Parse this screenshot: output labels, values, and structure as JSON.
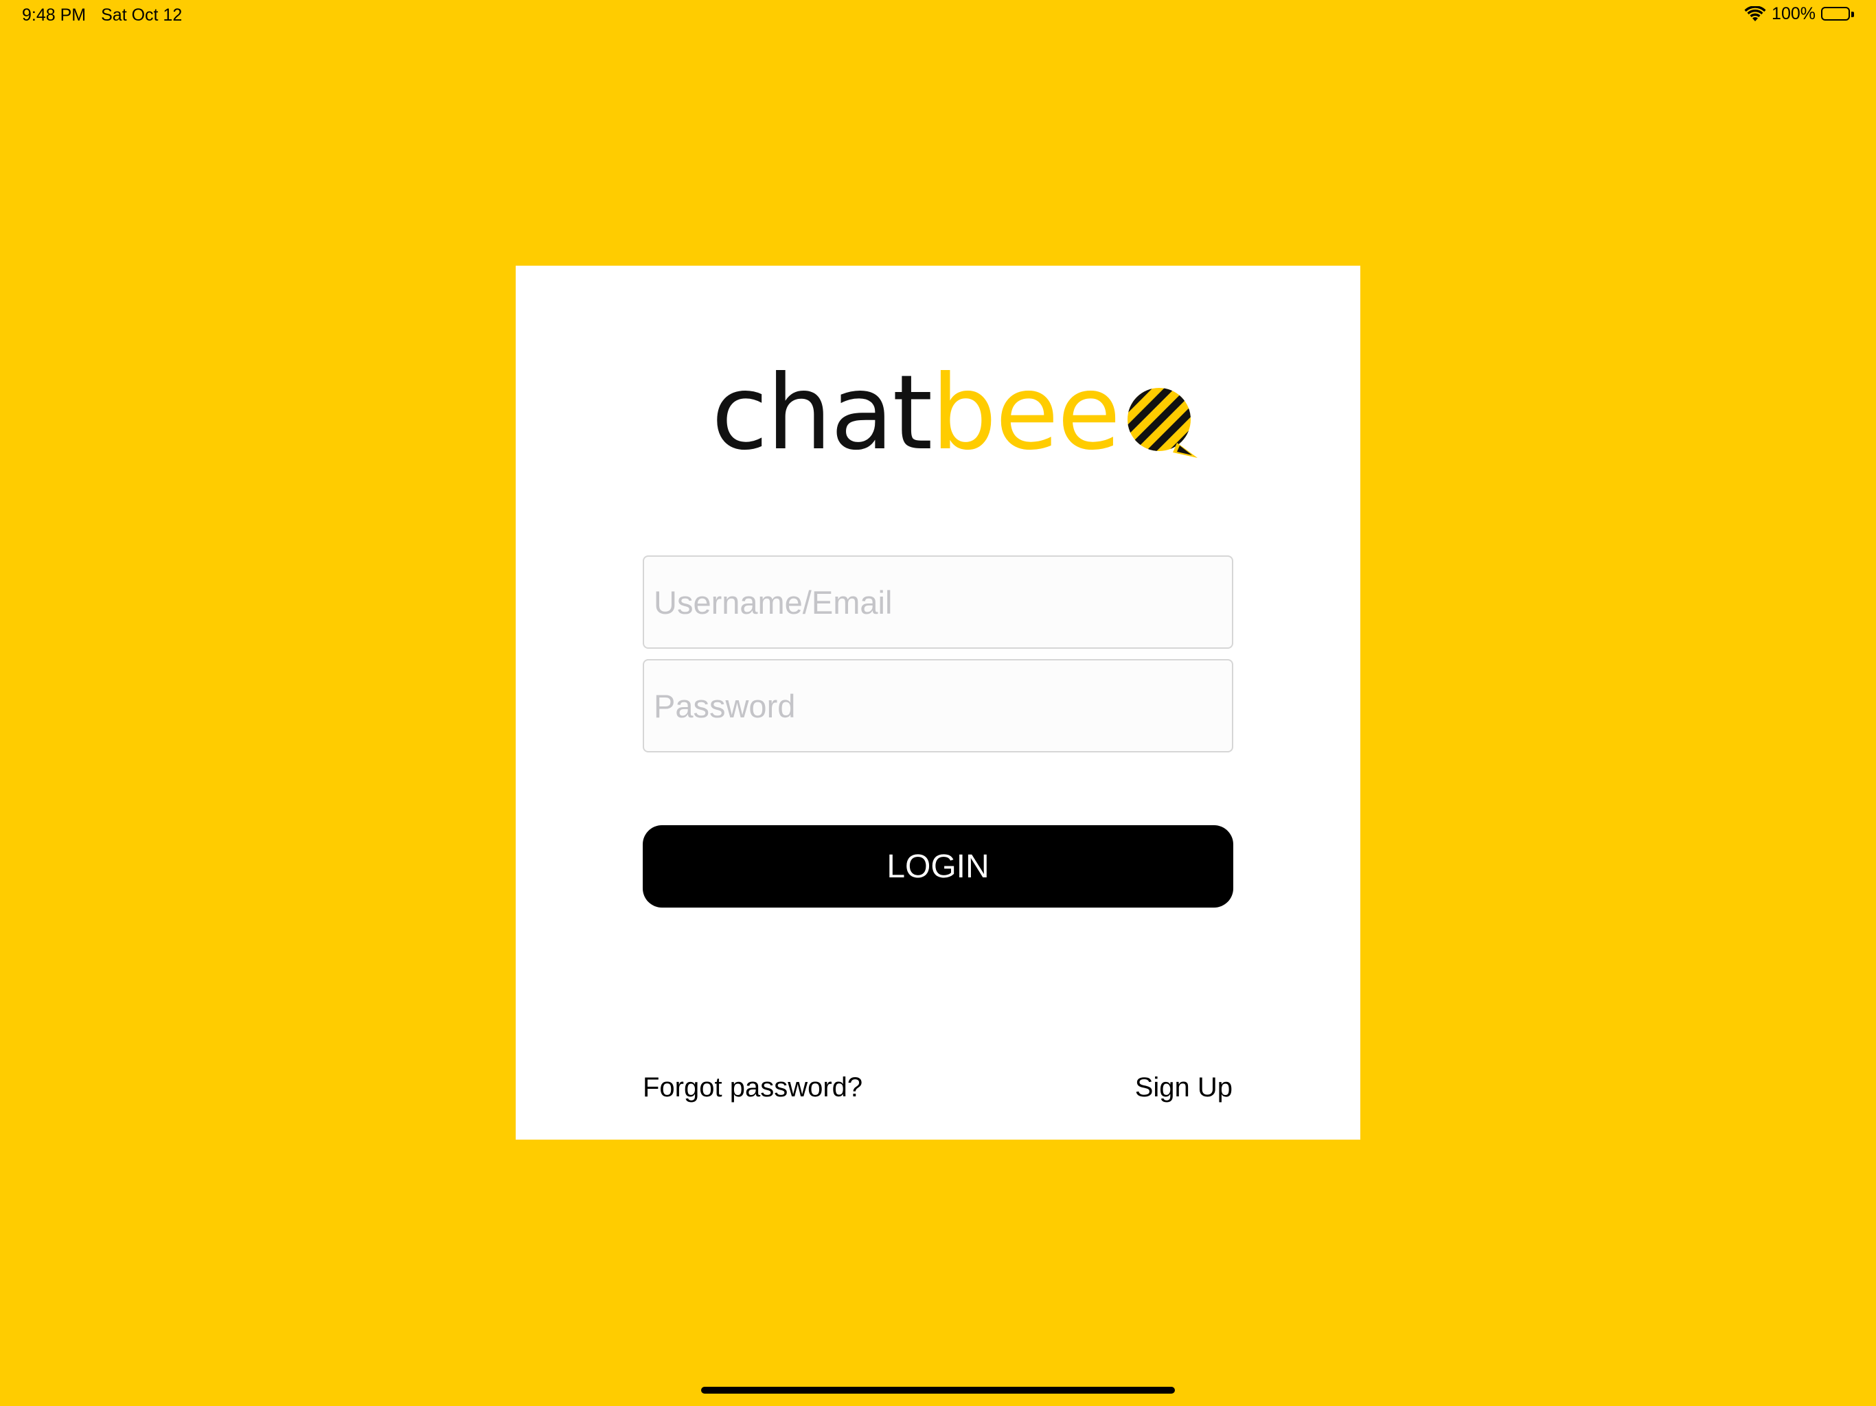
{
  "status_bar": {
    "time": "9:48 PM",
    "date": "Sat Oct 12",
    "battery_percent": "100%",
    "battery_level": 1.0,
    "icons": [
      "wifi-icon",
      "battery-icon"
    ]
  },
  "logo": {
    "part1": "chat",
    "part2": "bee",
    "icon": "speech-bubble-striped-icon"
  },
  "login_form": {
    "username_placeholder": "Username/Email",
    "username_value": "",
    "password_placeholder": "Password",
    "password_value": "",
    "login_label": "LOGIN",
    "forgot_label": "Forgot password?",
    "signup_label": "Sign Up"
  },
  "colors": {
    "background": "#FFCC00",
    "card": "#FFFFFF",
    "brand_yellow": "#FFCC00",
    "button": "#000000",
    "button_text": "#FFFFFF"
  }
}
